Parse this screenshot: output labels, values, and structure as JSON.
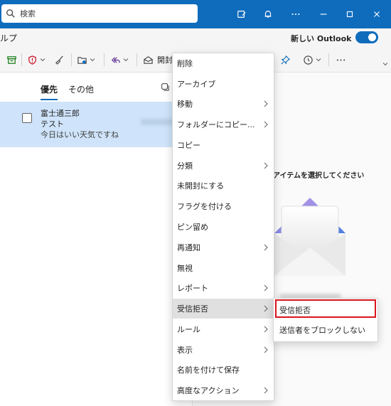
{
  "search": {
    "placeholder": "検索"
  },
  "tabrow": {
    "help_tab": "ルプ",
    "new_outlook_label": "新しい Outlook"
  },
  "ribbon": {
    "mark_unread_label": "開封"
  },
  "mail_list": {
    "tabs": {
      "focused": "優先",
      "other": "その他"
    },
    "message": {
      "sender": "富士通三郎",
      "subject": "テスト",
      "preview": "今日はいい天気ですね"
    }
  },
  "reading_pane": {
    "empty_message": "アイテムを選択してください"
  },
  "context_menu": {
    "items": [
      {
        "label": "削除"
      },
      {
        "label": "アーカイブ"
      },
      {
        "label": "移動"
      },
      {
        "label": "フォルダーにコピー..."
      },
      {
        "label": "コピー"
      },
      {
        "label": "分類"
      },
      {
        "label": "未開封にする"
      },
      {
        "label": "フラグを付ける"
      },
      {
        "label": "ピン留め"
      },
      {
        "label": "再通知"
      },
      {
        "label": "無視"
      },
      {
        "label": "レポート"
      },
      {
        "label": "受信拒否"
      },
      {
        "label": "ルール"
      },
      {
        "label": "表示"
      },
      {
        "label": "名前を付けて保存"
      },
      {
        "label": "高度なアクション"
      }
    ]
  },
  "submenu": {
    "items": [
      {
        "label": "受信拒否"
      },
      {
        "label": "送信者をブロックしない"
      }
    ]
  },
  "colors": {
    "accent": "#0f6cbd",
    "selected_row": "#cfe4fa",
    "highlight": "#d9141e"
  }
}
